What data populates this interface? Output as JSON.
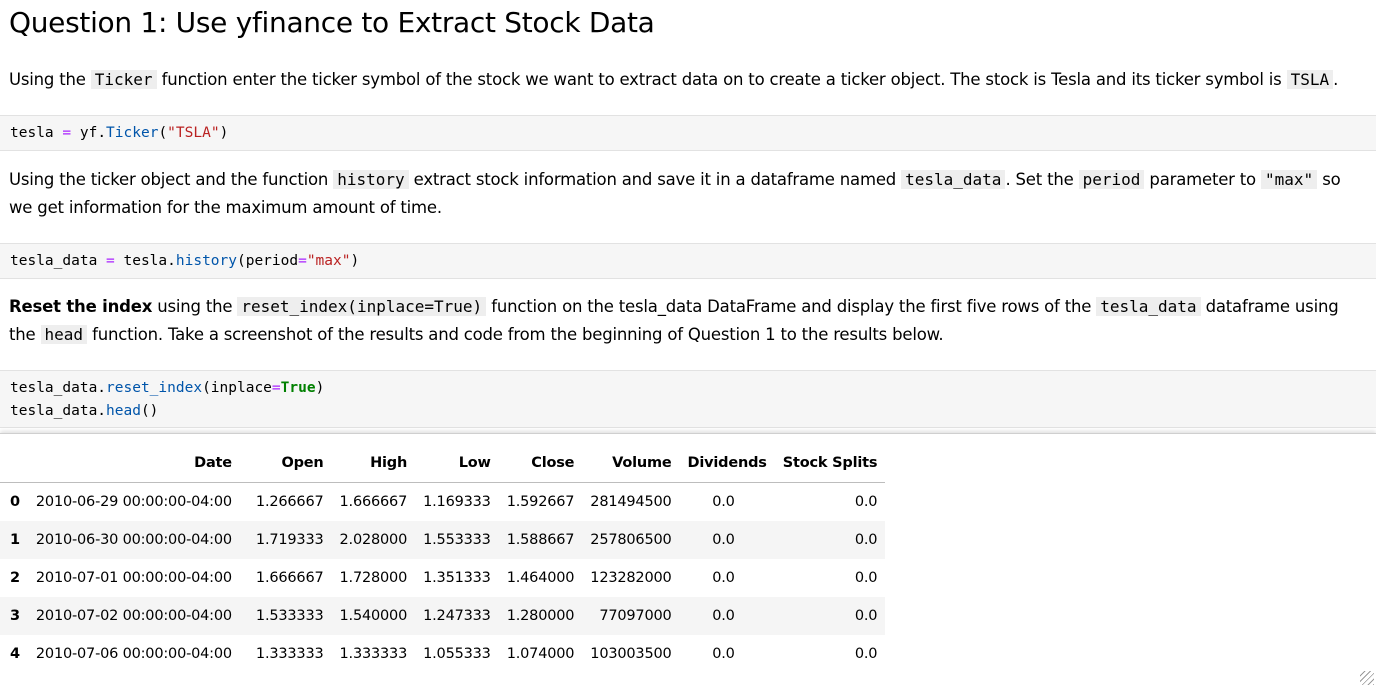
{
  "heading": "Question 1: Use yfinance to Extract Stock Data",
  "p1": {
    "a": "Using the ",
    "code1": "Ticker",
    "b": " function enter the ticker symbol of the stock we want to extract data on to create a ticker object. The stock is Tesla and its ticker symbol is ",
    "code2": "TSLA",
    "c": "."
  },
  "cell1": {
    "l1a": "tesla ",
    "l1op": "=",
    "l1b": " yf.",
    "l1fn": "Ticker",
    "l1c": "(",
    "l1str": "\"TSLA\"",
    "l1d": ")"
  },
  "p2": {
    "a": "Using the ticker object and the function ",
    "code1": "history",
    "b": " extract stock information and save it in a dataframe named ",
    "code2": "tesla_data",
    "c": ". Set the ",
    "code3": "period",
    "d": " parameter to ",
    "code4": "\"max\"",
    "e": " so we get information for the maximum amount of time."
  },
  "cell2": {
    "a": "tesla_data ",
    "op": "=",
    "b": " tesla.",
    "fn": "history",
    "c": "(period",
    "op2": "=",
    "str": "\"max\"",
    "d": ")"
  },
  "p3": {
    "bold": "Reset the index",
    "a": " using the ",
    "code1": "reset_index(inplace=True)",
    "b": " function on the tesla_data DataFrame and display the first five rows of the ",
    "code2": "tesla_data",
    "c": " dataframe using the ",
    "code3": "head",
    "d": " function. Take a screenshot of the results and code from the beginning of Question 1 to the results below."
  },
  "cell3": {
    "l1a": "tesla_data.",
    "l1fn": "reset_index",
    "l1b": "(inplace",
    "l1op": "=",
    "l1kw": "True",
    "l1c": ")",
    "l2a": "tesla_data.",
    "l2fn": "head",
    "l2b": "()"
  },
  "table": {
    "columns": [
      "",
      "Date",
      "Open",
      "High",
      "Low",
      "Close",
      "Volume",
      "Dividends",
      "Stock Splits"
    ],
    "rows": [
      [
        "0",
        "2010-06-29 00:00:00-04:00",
        "1.266667",
        "1.666667",
        "1.169333",
        "1.592667",
        "281494500",
        "0.0",
        "0.0"
      ],
      [
        "1",
        "2010-06-30 00:00:00-04:00",
        "1.719333",
        "2.028000",
        "1.553333",
        "1.588667",
        "257806500",
        "0.0",
        "0.0"
      ],
      [
        "2",
        "2010-07-01 00:00:00-04:00",
        "1.666667",
        "1.728000",
        "1.351333",
        "1.464000",
        "123282000",
        "0.0",
        "0.0"
      ],
      [
        "3",
        "2010-07-02 00:00:00-04:00",
        "1.533333",
        "1.540000",
        "1.247333",
        "1.280000",
        "77097000",
        "0.0",
        "0.0"
      ],
      [
        "4",
        "2010-07-06 00:00:00-04:00",
        "1.333333",
        "1.333333",
        "1.055333",
        "1.074000",
        "103003500",
        "0.0",
        "0.0"
      ]
    ]
  }
}
